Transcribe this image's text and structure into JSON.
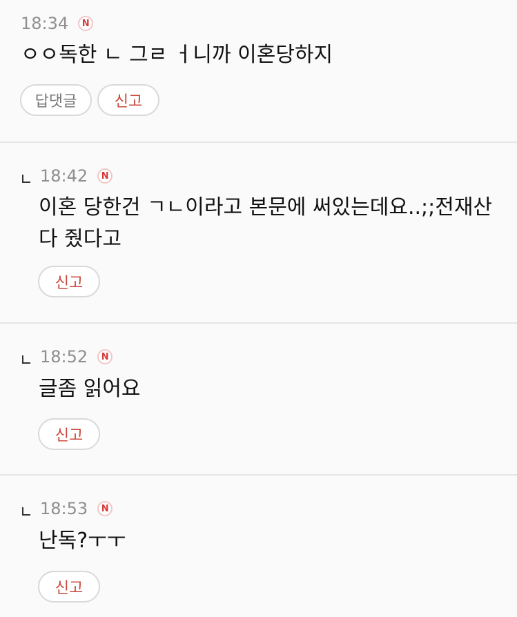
{
  "comments": [
    {
      "time": "18:34",
      "badge": "N",
      "text": "ㅇㅇ독한 ㄴ 그ㄹ ㅓ니까 이혼당하지",
      "reply_label": "답댓글",
      "report_label": "신고",
      "is_reply": false
    },
    {
      "time": "18:42",
      "badge": "N",
      "text": "이혼 당한건 ㄱㄴ이라고 본문에 써있는데요..;;전재산\n다 줬다고",
      "report_label": "신고",
      "is_reply": true
    },
    {
      "time": "18:52",
      "badge": "N",
      "text": "글좀 읽어요",
      "report_label": "신고",
      "is_reply": true
    },
    {
      "time": "18:53",
      "badge": "N",
      "text": "난독?ㅜㅜ",
      "report_label": "신고",
      "is_reply": true
    }
  ],
  "colors": {
    "badge": "#d63b3b",
    "report_text": "#c9493e",
    "time_text": "#8e8e8e",
    "divider": "#e6e6e6"
  }
}
